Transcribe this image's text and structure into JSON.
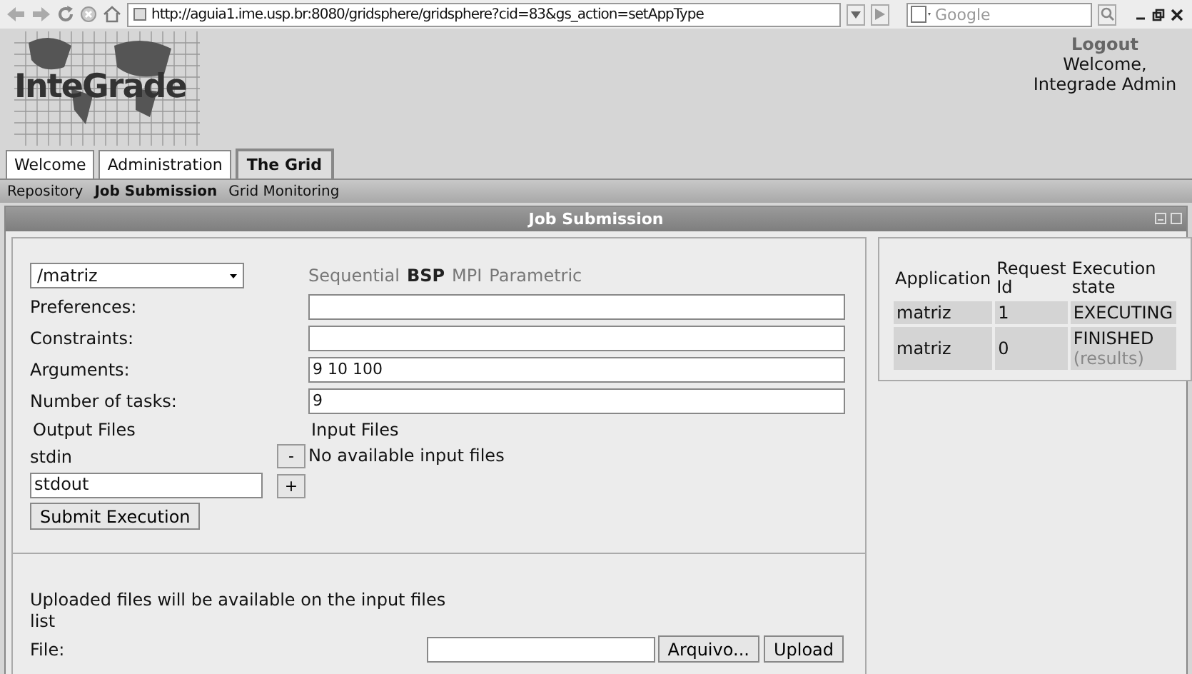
{
  "browser": {
    "url": "http://aguia1.ime.usp.br:8080/gridsphere/gridsphere?cid=83&gs_action=setAppType",
    "search_placeholder": "Google"
  },
  "header": {
    "logo": "InteGrade",
    "logout": "Logout",
    "welcome": "Welcome, Integrade Admin"
  },
  "tabs": [
    {
      "label": "Welcome",
      "selected": false
    },
    {
      "label": "Administration",
      "selected": false
    },
    {
      "label": "The Grid",
      "selected": true
    }
  ],
  "subnav": [
    {
      "label": "Repository",
      "selected": false
    },
    {
      "label": "Job Submission",
      "selected": true
    },
    {
      "label": "Grid Monitoring",
      "selected": false
    }
  ],
  "panel": {
    "title": "Job Submission"
  },
  "form": {
    "application": "/matriz",
    "job_types": [
      {
        "label": "Sequential",
        "selected": false
      },
      {
        "label": "BSP",
        "selected": true
      },
      {
        "label": "MPI",
        "selected": false
      },
      {
        "label": "Parametric",
        "selected": false
      }
    ],
    "fields": [
      {
        "label": "Preferences:"
      },
      {
        "label": "Constraints:"
      },
      {
        "label": "Arguments:",
        "value": "9 10 100"
      },
      {
        "label": "Number of tasks:",
        "value": "9"
      }
    ],
    "output_files": {
      "heading": "Output Files",
      "items": [
        "stdin"
      ],
      "new_value": "stdout",
      "remove": "-",
      "add": "+"
    },
    "input_files": {
      "heading": "Input Files",
      "empty": "No available input files"
    },
    "submit": "Submit Execution"
  },
  "upload": {
    "note": "Uploaded files will be available on the input files list",
    "label": "File:",
    "browse": "Arquivo...",
    "button": "Upload"
  },
  "requests": {
    "columns": [
      "Application",
      "Request Id",
      "Execution state"
    ],
    "rows": [
      {
        "application": "matriz",
        "id": "1",
        "state": "EXECUTING"
      },
      {
        "application": "matriz",
        "id": "0",
        "state": "FINISHED",
        "link": "(results)"
      }
    ]
  }
}
